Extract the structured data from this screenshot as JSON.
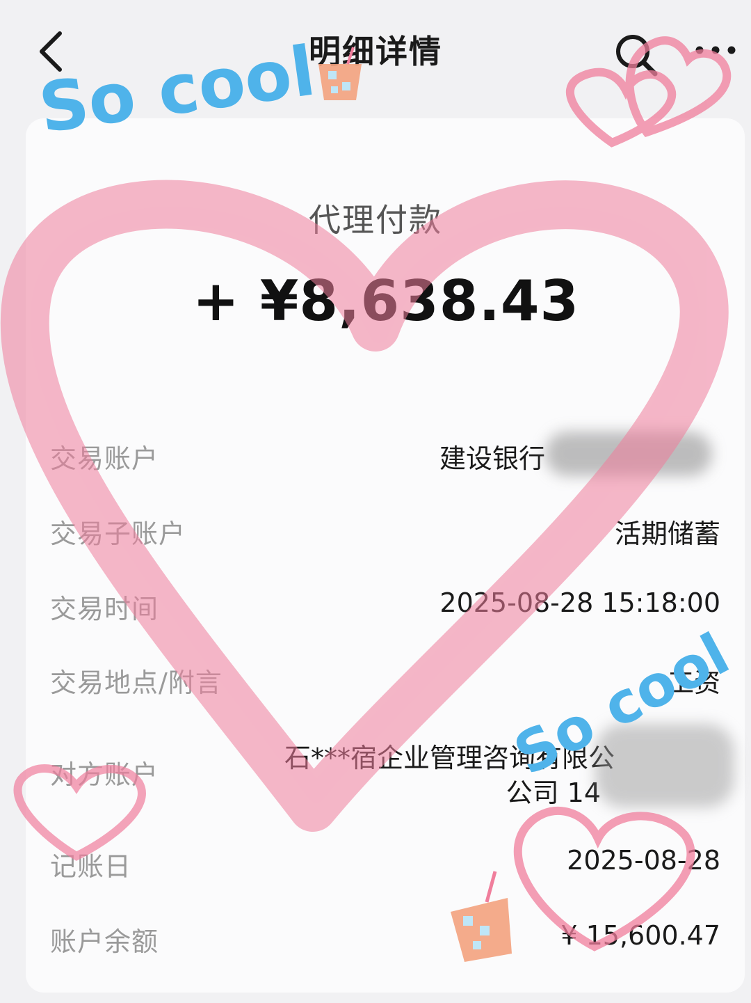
{
  "header": {
    "title": "明细详情",
    "back_icon": "chevron-left-icon",
    "search_icon": "search-icon",
    "more_icon": "more-dots-icon"
  },
  "transaction": {
    "type": "代理付款",
    "amount": "+ ¥8,638.43"
  },
  "details": [
    {
      "label": "交易账户",
      "value": "建设银行"
    },
    {
      "label": "交易子账户",
      "value": "活期储蓄"
    },
    {
      "label": "交易时间",
      "value": "2025-08-28 15:18:00"
    },
    {
      "label": "交易地点/附言",
      "value": "工资"
    },
    {
      "label": "对方账户",
      "value": "石***宿企业管理咨询有限公",
      "value_line2": "公司 14"
    },
    {
      "label": "记账日",
      "value": "2025-08-28"
    },
    {
      "label": "账户余额",
      "value": "¥ 15,600.47"
    }
  ],
  "stickers": {
    "text": "So cool",
    "color": "#4fb3ea",
    "heart_color": "#f07e9c"
  }
}
